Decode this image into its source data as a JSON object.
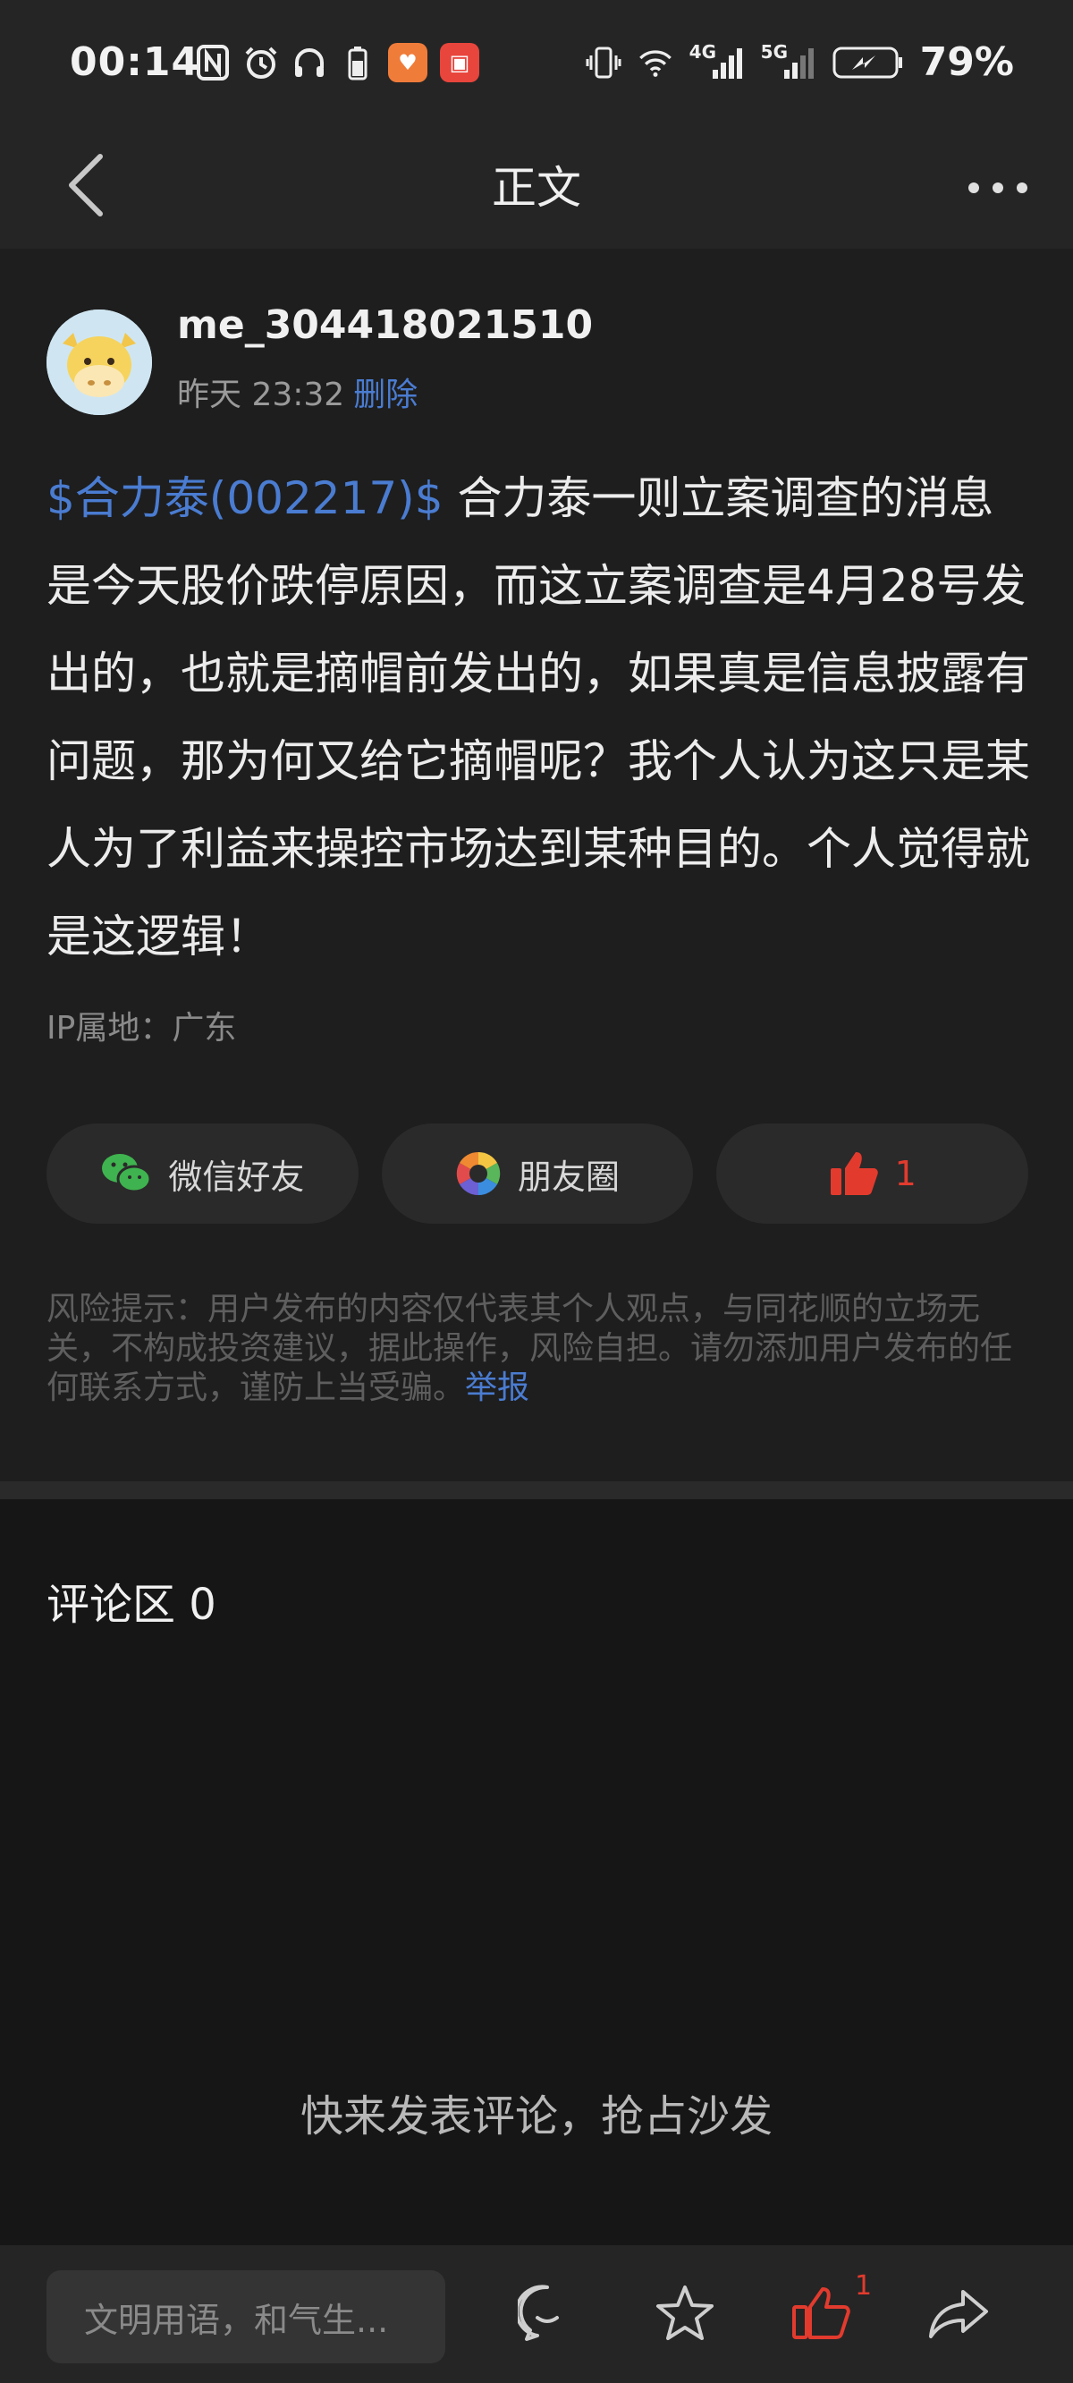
{
  "status_bar": {
    "time": "00:14",
    "battery": "79%",
    "network_4g": "4G",
    "network_5g": "5G"
  },
  "nav": {
    "title": "正文"
  },
  "post": {
    "username": "me_304418021510",
    "timestamp": "昨天 23:32",
    "delete_label": "删除",
    "stock_tag": "$合力泰(002217)$",
    "content": " 合力泰一则立案调查的消息是今天股价跌停原因，而这立案调查是4月28号发出的，也就是摘帽前发出的，如果真是信息披露有问题，那为何又给它摘帽呢？我个人认为这只是某人为了利益来操控市场达到某种目的。个人觉得就是这逻辑！",
    "ip_location": "IP属地：广东",
    "share_wechat_label": "微信好友",
    "share_moments_label": "朋友圈",
    "like_count": "1",
    "risk_notice": "风险提示：用户发布的内容仅代表其个人观点，与同花顺的立场无关，不构成投资建议，据此操作，风险自担。请勿添加用户发布的任何联系方式，谨防上当受骗。",
    "report_label": "举报"
  },
  "comments": {
    "title": "评论区 0",
    "empty_hint": "快来发表评论，抢占沙发"
  },
  "bottom_bar": {
    "input_placeholder": "文明用语，和气生...",
    "like_count": "1"
  },
  "colors": {
    "link_blue": "#4a7cd1",
    "like_red": "#e23b2e",
    "wechat_green": "#3fb34f"
  }
}
